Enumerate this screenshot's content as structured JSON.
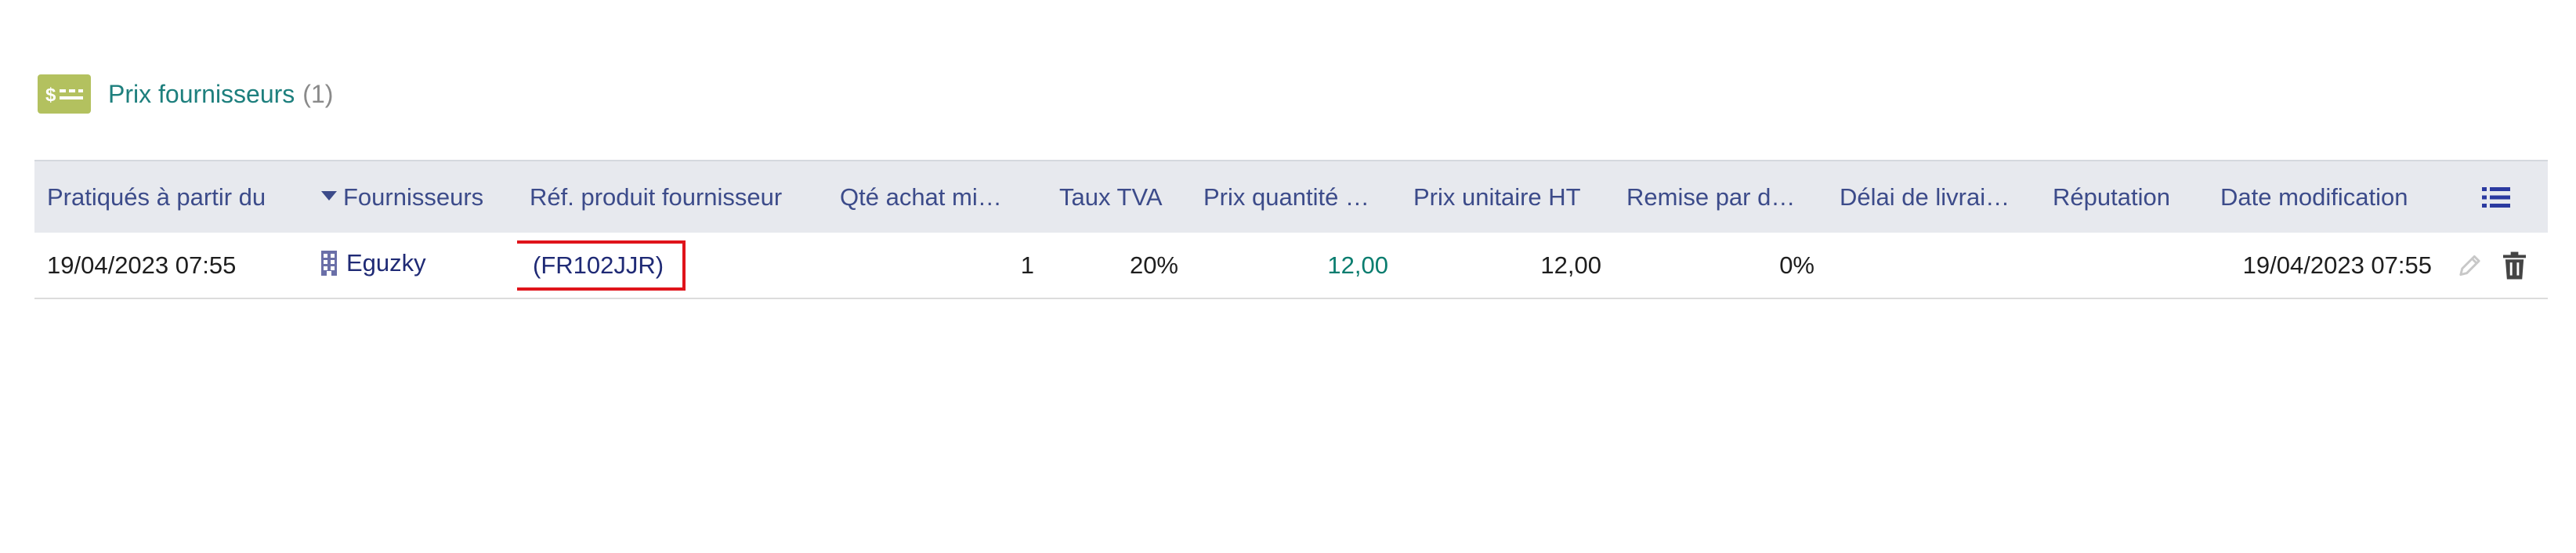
{
  "section": {
    "icon": "supplier-price-icon",
    "title": "Prix fournisseurs",
    "count": "(1)"
  },
  "table": {
    "columns": [
      "Pratiqués à partir du",
      "Fournisseurs",
      "Réf. produit fournisseur",
      "Qté achat mi…",
      "Taux TVA",
      "Prix quantité …",
      "Prix unitaire HT",
      "Remise par d…",
      "Délai de livrai…",
      "Réputation",
      "Date modification"
    ],
    "rows": [
      {
        "date_from": "19/04/2023 07:55",
        "supplier": "Eguzky",
        "ref": "(FR102JJR)",
        "qty_min": "1",
        "vat": "20%",
        "price_qty": "12,00",
        "unit_price": "12,00",
        "discount": "0%",
        "delivery": "",
        "reputation": "",
        "date_mod": "19/04/2023 07:55"
      }
    ]
  },
  "colors": {
    "accent": "#1d7f7d",
    "icon_bg": "#b3c15f",
    "header_text": "#3c4b8a",
    "link": "#1f2a75",
    "highlight_border": "#e0141b"
  }
}
